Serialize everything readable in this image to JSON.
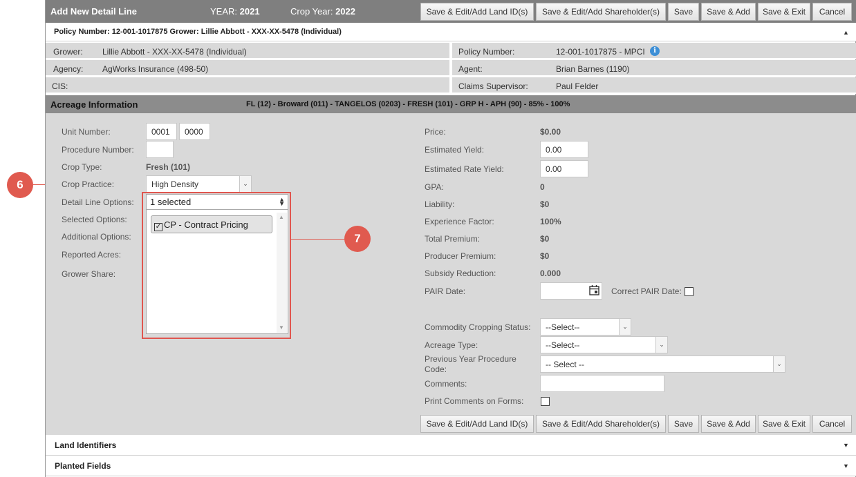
{
  "header": {
    "title": "Add New Detail Line",
    "year_label": "YEAR:",
    "year_value": "2021",
    "crop_year_label": "Crop Year:",
    "crop_year_value": "2022"
  },
  "buttons": {
    "land_ids": "Save & Edit/Add Land ID(s)",
    "shareholders": "Save & Edit/Add Shareholder(s)",
    "save": "Save",
    "save_add": "Save & Add",
    "save_exit": "Save & Exit",
    "cancel": "Cancel"
  },
  "policy_header": "Policy Number: 12-001-1017875 Grower: Lillie Abbott - XXX-XX-5478 (Individual)",
  "info": {
    "grower_label": "Grower:",
    "grower_value": "Lillie Abbott - XXX-XX-5478 (Individual)",
    "policy_label": "Policy Number:",
    "policy_value": "12-001-1017875 - MPCI",
    "agency_label": "Agency:",
    "agency_value": "AgWorks Insurance (498-50)",
    "agent_label": "Agent:",
    "agent_value": "Brian Barnes (1190)",
    "cis_label": "CIS:",
    "claims_label": "Claims Supervisor:",
    "claims_value": "Paul Felder"
  },
  "acreage": {
    "title": "Acreage Information",
    "detail": "FL (12) - Broward (011) - TANGELOS (0203) - FRESH (101) - GRP H - APH (90) - 85% - 100%"
  },
  "left": {
    "unit_number_label": "Unit Number:",
    "unit_number_1": "0001",
    "unit_number_2": "0000",
    "procedure_number_label": "Procedure Number:",
    "crop_type_label": "Crop Type:",
    "crop_type_value": "Fresh (101)",
    "crop_practice_label": "Crop Practice:",
    "crop_practice_value": "High Density",
    "detail_options_label": "Detail Line Options:",
    "detail_options_value": "1 selected",
    "selected_options_label": "Selected Options:",
    "selected_option_chip": "CP - Contract Pricing",
    "additional_options_label": "Additional Options:",
    "reported_acres_label": "Reported Acres:",
    "grower_share_label": "Grower Share:"
  },
  "right": {
    "price_label": "Price:",
    "price_value": "$0.00",
    "est_yield_label": "Estimated Yield:",
    "est_yield_value": "0.00",
    "est_rate_yield_label": "Estimated Rate Yield:",
    "est_rate_yield_value": "0.00",
    "gpa_label": "GPA:",
    "gpa_value": "0",
    "liability_label": "Liability:",
    "liability_value": "$0",
    "exp_factor_label": "Experience Factor:",
    "exp_factor_value": "100%",
    "total_premium_label": "Total Premium:",
    "total_premium_value": "$0",
    "producer_premium_label": "Producer Premium:",
    "producer_premium_value": "$0",
    "subsidy_label": "Subsidy Reduction:",
    "subsidy_value": "0.000",
    "pair_date_label": "PAIR Date:",
    "correct_pair_label": "Correct PAIR Date:",
    "commodity_status_label": "Commodity Cropping Status:",
    "commodity_status_value": "--Select--",
    "acreage_type_label": "Acreage Type:",
    "acreage_type_value": "--Select--",
    "prev_year_label_1": "Previous Year Procedure",
    "prev_year_label_2": "Code:",
    "prev_year_value": "-- Select --",
    "comments_label": "Comments:",
    "print_comments_label": "Print Comments on Forms:"
  },
  "callouts": {
    "a": "6",
    "b": "7"
  },
  "accordion": {
    "land": "Land Identifiers",
    "planted": "Planted Fields"
  },
  "colors": {
    "callout": "#e05a4f",
    "header_bar": "#7f7f7f",
    "panel": "#d9d9d9"
  }
}
